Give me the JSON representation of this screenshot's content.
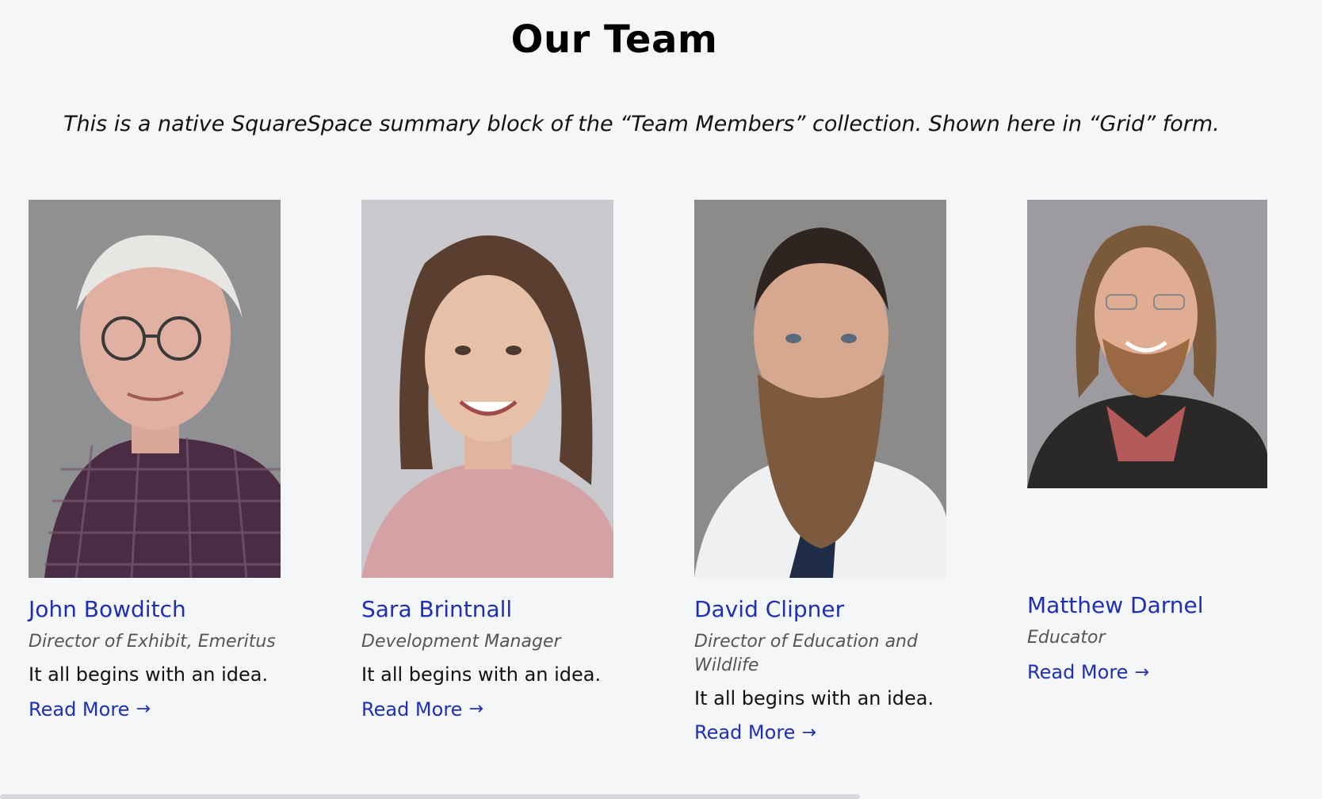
{
  "page": {
    "title": "Our Team",
    "intro": "This is a native SquareSpace summary block of the “Team Members” collection.  Shown here in “Grid” form."
  },
  "members": [
    {
      "name": "John Bowditch",
      "role": "Director of Exhibit, Emeritus",
      "excerpt": "It all begins with an idea.",
      "read_more": "Read More",
      "arrow": "→"
    },
    {
      "name": "Sara Brintnall",
      "role": "Development Manager",
      "excerpt": "It all begins with an idea.",
      "read_more": "Read More",
      "arrow": "→"
    },
    {
      "name": "David Clipner",
      "role": "Director of Education and Wildlife",
      "excerpt": "It all begins with an idea.",
      "read_more": "Read More",
      "arrow": "→"
    },
    {
      "name": "Matthew Darnel",
      "role": "Educator",
      "read_more": "Read More",
      "arrow": "→"
    }
  ],
  "colors": {
    "background": "#f4f6f8",
    "link": "#1f2fb4",
    "role_text": "#555555"
  }
}
